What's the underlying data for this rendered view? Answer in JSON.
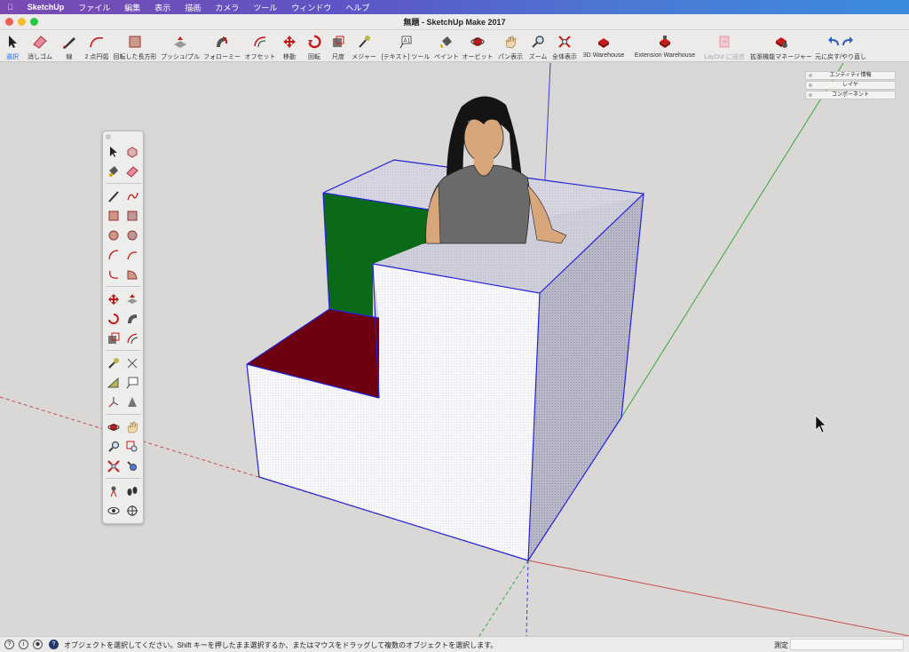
{
  "menubar": {
    "apple": "",
    "app_name": "SketchUp",
    "items": [
      "ファイル",
      "編集",
      "表示",
      "描画",
      "カメラ",
      "ツール",
      "ウィンドウ",
      "ヘルプ"
    ]
  },
  "window": {
    "title": "無題 - SketchUp Make 2017"
  },
  "toolbar": {
    "items": [
      {
        "label": "選択",
        "icon": "arrow-select-icon"
      },
      {
        "label": "消しゴム",
        "icon": "eraser-icon"
      },
      {
        "label": "線",
        "icon": "pencil-icon"
      },
      {
        "label": "2 点円弧",
        "icon": "arc-icon"
      },
      {
        "label": "回転した長方形",
        "icon": "rotated-rectangle-icon"
      },
      {
        "label": "プッシュ/プル",
        "icon": "push-pull-icon"
      },
      {
        "label": "フォローミー",
        "icon": "follow-me-icon"
      },
      {
        "label": "オフセット",
        "icon": "offset-icon"
      },
      {
        "label": "移動",
        "icon": "move-icon"
      },
      {
        "label": "回転",
        "icon": "rotate-icon"
      },
      {
        "label": "尺度",
        "icon": "scale-icon"
      },
      {
        "label": "メジャー",
        "icon": "tape-measure-icon"
      },
      {
        "label": "[テキスト] ツール",
        "icon": "text-tool-icon"
      },
      {
        "label": "ペイント",
        "icon": "paint-bucket-icon"
      },
      {
        "label": "オービット",
        "icon": "orbit-icon"
      },
      {
        "label": "パン表示",
        "icon": "pan-hand-icon"
      },
      {
        "label": "ズーム",
        "icon": "zoom-icon"
      },
      {
        "label": "全体表示",
        "icon": "zoom-extents-icon"
      },
      {
        "label": "3D Warehouse",
        "icon": "warehouse-icon"
      },
      {
        "label": "Extension Warehouse",
        "icon": "extension-warehouse-icon"
      },
      {
        "label": "LayOut に送信",
        "icon": "send-to-layout-icon"
      },
      {
        "label": "拡張機能マネージャー",
        "icon": "extension-manager-icon"
      },
      {
        "label": "元に戻す/やり直し",
        "icon": "undo-redo-icon"
      }
    ],
    "colors": {
      "accent": "#1d6ff0",
      "tool_red": "#c41a1a"
    }
  },
  "trays": [
    "エンティティ情報",
    "レイヤ",
    "コンポーネント"
  ],
  "scene": {
    "colors": {
      "background": "#d9d8d6",
      "edge": "#2323d6",
      "green_face": "#0a6a18",
      "red_face": "#6e0010",
      "front_face": "#f7f7fa",
      "side_face": "#b9b8c9",
      "top_face": "#d6d5e1",
      "axis_red": "#c84d4d",
      "axis_green": "#3ba63b",
      "axis_blue": "#3d3de0",
      "figure_shirt": "#6b6b6b",
      "figure_skin": "#d7a67a",
      "figure_hair": "#141414"
    }
  },
  "statusbar": {
    "message": "オブジェクトを選択してください。Shift キーを押したまま選択するか、またはマウスをドラッグして複数のオブジェクトを選択します。",
    "measure_label": "測定",
    "measure_value": ""
  }
}
